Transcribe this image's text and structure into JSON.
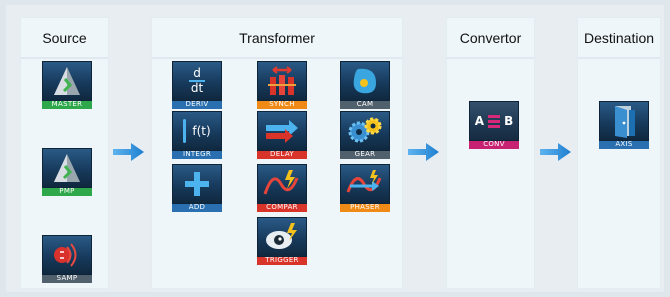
{
  "columns": {
    "source": "Source",
    "transformer": "Transformer",
    "convertor": "Convertor",
    "destination": "Destination"
  },
  "blocks": {
    "master": "MASTER",
    "pmp": "PMP",
    "samp": "SAMP",
    "deriv": "DERIV",
    "integr": "INTEGR",
    "add": "ADD",
    "synch": "SYNCH",
    "delay": "DELAY",
    "compar": "COMPAR",
    "trigger": "TRIGGER",
    "cam": "CAM",
    "gear": "GEAR",
    "phaser": "PHASER",
    "conv": "CONV",
    "axis": "AXIS"
  },
  "icon_text": {
    "deriv_top": "d",
    "deriv_bottom": "dt",
    "integr_fn": "f(t)",
    "conv_a": "A",
    "conv_b": "B"
  },
  "icons": {
    "master": "master-pyramid-icon",
    "pmp": "pmp-pyramid-icon",
    "samp": "sampling-wave-icon",
    "deriv": "derivative-icon",
    "integr": "integral-icon",
    "add": "plus-icon",
    "synch": "synch-icon",
    "delay": "delay-arrow-icon",
    "compar": "compare-wave-icon",
    "trigger": "trigger-eye-icon",
    "cam": "cam-icon",
    "gear": "gears-icon",
    "phaser": "phaser-icon",
    "conv": "convert-icon",
    "axis": "axis-door-icon",
    "flow": "flow-arrow-icon"
  },
  "colors": {
    "label_green": "#2ea84a",
    "label_blue": "#2a6fb0",
    "label_orange": "#f08a16",
    "label_red": "#d8342a",
    "label_magenta": "#c72272",
    "label_gray": "#50606c",
    "arrow_blue": "#2b8fdb"
  }
}
